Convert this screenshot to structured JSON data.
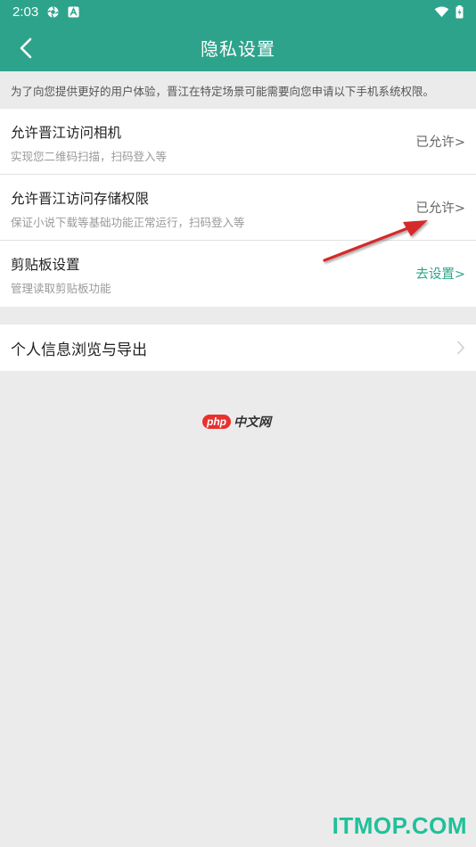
{
  "status_bar": {
    "time": "2:03",
    "icons": [
      "settings-gear-icon",
      "a-notification-icon",
      "wifi-icon",
      "battery-charging-icon"
    ]
  },
  "nav": {
    "back_icon": "chevron-left-icon",
    "title": "隐私设置"
  },
  "notice": "为了向您提供更好的用户体验，晋江在特定场景可能需要向您申请以下手机系统权限。",
  "permissions": [
    {
      "title": "允许晋江访问相机",
      "description": "实现您二维码扫描，扫码登入等",
      "status": "已允许>"
    },
    {
      "title": "允许晋江访问存储权限",
      "description": "保证小说下载等基础功能正常运行，扫码登入等",
      "status": "已允许>"
    },
    {
      "title": "剪贴板设置",
      "description": "管理读取剪贴板功能",
      "status": "去设置>"
    }
  ],
  "personal_info": {
    "label": "个人信息浏览与导出",
    "icon": "chevron-right-icon"
  },
  "logo": {
    "badge": "php",
    "text": "中文网"
  },
  "watermark": "ITMOP.COM",
  "colors": {
    "accent": "#2ea38c",
    "annotation_arrow": "#d42a2a",
    "background": "#ebebeb"
  }
}
